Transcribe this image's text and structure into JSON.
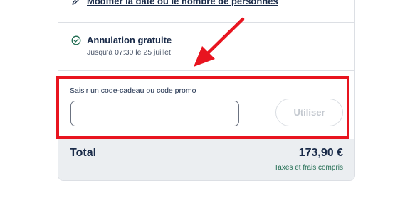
{
  "booking": {
    "modify_link": "Modifier la date ou le nombre de personnes",
    "cancellation": {
      "title": "Annulation gratuite",
      "subtitle": "Jusqu’à 07:30 le 25 juillet"
    }
  },
  "promo": {
    "label": "Saisir un code-cadeau ou code promo",
    "input_value": "",
    "apply_label": "Utiliser"
  },
  "total": {
    "label": "Total",
    "amount": "173,90 €",
    "taxes_note": "Taxes et frais compris"
  },
  "colors": {
    "annotation_red": "#e8141f",
    "text_navy": "#1a2b49",
    "success_green": "#1f6b50",
    "total_bg": "#ebeef1"
  },
  "icons": {
    "modify": "pencil-icon",
    "cancellation": "check-circle-icon"
  }
}
